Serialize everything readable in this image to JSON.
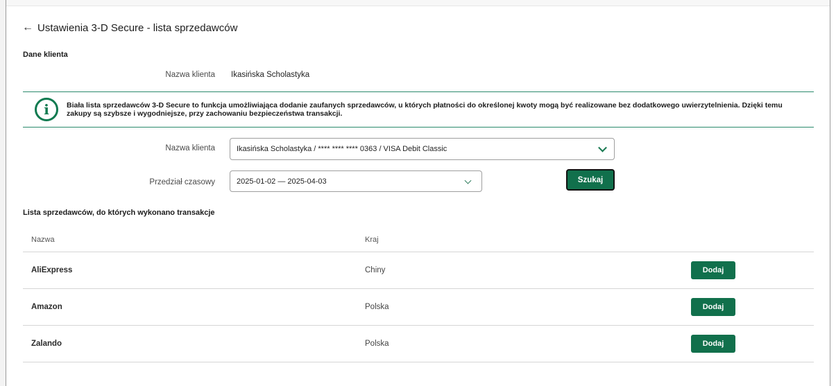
{
  "header": {
    "back_icon": "←",
    "title": "Ustawienia 3-D Secure - lista sprzedawców"
  },
  "client_data": {
    "section_title": "Dane klienta",
    "name_label": "Nazwa klienta",
    "name_value": "Ikasińska Scholastyka"
  },
  "info": {
    "icon": "i",
    "text": "Biała lista sprzedawców 3-D Secure to funkcja umożliwiająca dodanie zaufanych sprzedawców, u których płatności do określonej kwoty mogą być realizowane bez dodatkowego uwierzytelnienia. Dzięki temu zakupy są szybsze i wygodniejsze, przy zachowaniu bezpieczeństwa transakcji."
  },
  "filters": {
    "client_label": "Nazwa klienta",
    "client_value": "Ikasińska Scholastyka / **** **** **** 0363 / VISA Debit Classic",
    "period_label": "Przedział czasowy",
    "period_value": "2025-01-02 — 2025-04-03",
    "search_button": "Szukaj"
  },
  "merchants": {
    "section_title": "Lista sprzedawców, do których wykonano transakcje",
    "columns": [
      "Nazwa",
      "Kraj"
    ],
    "rows": [
      {
        "name": "AliExpress",
        "country": "Chiny",
        "action": "Dodaj"
      },
      {
        "name": "Amazon",
        "country": "Polska",
        "action": "Dodaj"
      },
      {
        "name": "Zalando",
        "country": "Polska",
        "action": "Dodaj"
      }
    ]
  },
  "colors": {
    "primary_green": "#11704c",
    "divider_green": "#2a8a6c"
  }
}
